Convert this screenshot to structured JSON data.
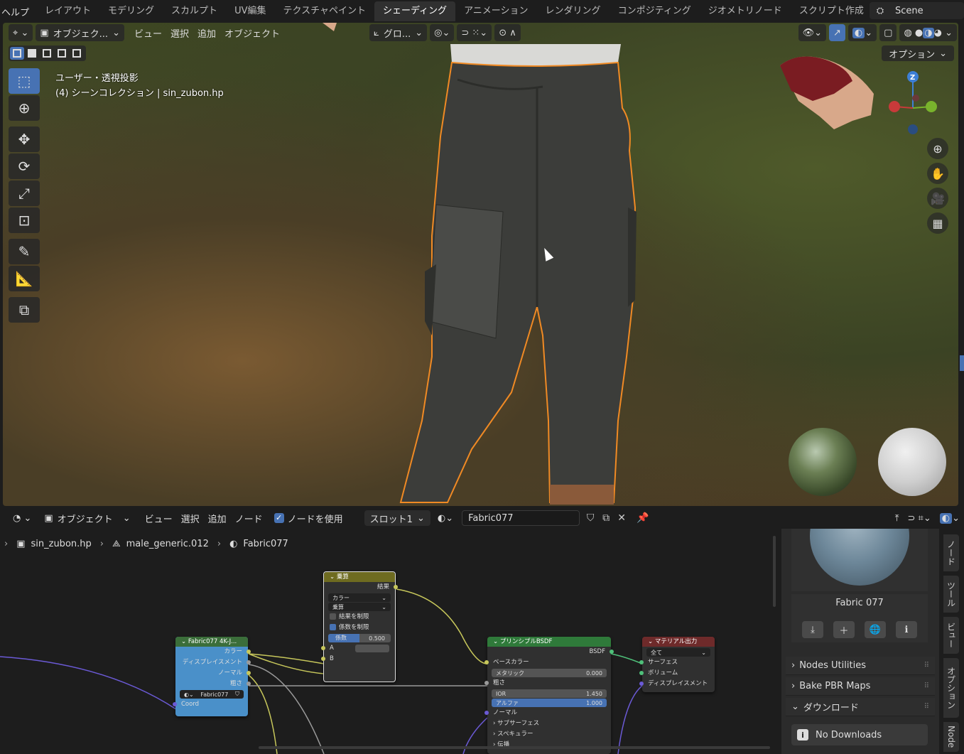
{
  "topbar": {
    "help": "ヘルプ",
    "tabs": [
      "レイアウト",
      "モデリング",
      "スカルプト",
      "UV編集",
      "テクスチャペイント",
      "シェーディング",
      "アニメーション",
      "レンダリング",
      "コンポジティング",
      "ジオメトリノード",
      "スクリプト作成"
    ],
    "active_tab": "シェーディング",
    "scene": "Scene"
  },
  "viewport": {
    "mode": "オブジェク...",
    "menus": [
      "ビュー",
      "選択",
      "追加",
      "オブジェクト"
    ],
    "transform": "グロ...",
    "options": "オプション",
    "info_line1": "ユーザー・透視投影",
    "info_line2": "(4) シーンコレクション | sin_zubon.hp",
    "gizmo_z": "Z"
  },
  "node_editor": {
    "mode": "オブジェクト",
    "menus": [
      "ビュー",
      "選択",
      "追加",
      "ノード"
    ],
    "use_nodes": "ノードを使用",
    "slot": "スロット1",
    "material": "Fabric077",
    "breadcrumb": [
      "sin_zubon.hp",
      "male_generic.012",
      "Fabric077"
    ]
  },
  "nodes": {
    "multiply": {
      "title": "乗算",
      "result": "結果",
      "type": "カラー",
      "op": "乗算",
      "clamp_result": "結果を制限",
      "clamp_factor": "係数を制限",
      "factor_label": "係数",
      "factor_value": "0.500",
      "a": "A",
      "b": "B"
    },
    "texture": {
      "title": "Fabric077 4K-J...",
      "color": "カラー",
      "displacement": "ディスプレイスメント",
      "normal": "ノーマル",
      "roughness": "粗さ",
      "material": "Fabric077",
      "coord": "Coord"
    },
    "bsdf": {
      "title": "プリンシプルBSDF",
      "out": "BSDF",
      "base_color": "ベースカラー",
      "metallic": "メタリック",
      "metallic_value": "0.000",
      "roughness": "粗さ",
      "ior": "IOR",
      "ior_value": "1.450",
      "alpha": "アルファ",
      "alpha_value": "1.000",
      "normal": "ノーマル",
      "subsurface": "サブサーフェス",
      "specular": "スペキュラー",
      "transmission": "伝播"
    },
    "output": {
      "title": "マテリアル出力",
      "target": "全て",
      "surface": "サーフェス",
      "volume": "ボリューム",
      "displacement": "ディスプレイスメント"
    }
  },
  "side_panel": {
    "asset_name": "Fabric 077",
    "sections": [
      "Nodes Utilities",
      "Bake PBR Maps",
      "ダウンロード"
    ],
    "no_downloads": "No Downloads",
    "tabs": [
      "ノード",
      "ツール",
      "ビュー",
      "オプション",
      "Node"
    ]
  },
  "colors": {
    "accent": "#4772b3",
    "selection_outline": "#f08a24",
    "node_texture": "#4a90c9",
    "node_bsdf_header": "#2f7a3a",
    "node_output_header": "#6e2a2a",
    "node_multiply_header": "#6e6b20"
  }
}
